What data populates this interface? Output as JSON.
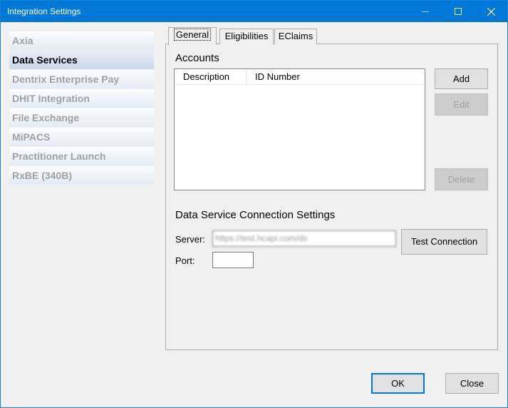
{
  "window": {
    "title": "Integration Settings",
    "accent_color": "#0078d7"
  },
  "nav": {
    "items": [
      {
        "label": "Axia",
        "selected": false
      },
      {
        "label": "Data Services",
        "selected": true
      },
      {
        "label": "Dentrix Enterprise Pay",
        "selected": false
      },
      {
        "label": "DHIT Integration",
        "selected": false
      },
      {
        "label": "File Exchange",
        "selected": false
      },
      {
        "label": "MiPACS",
        "selected": false
      },
      {
        "label": "Practitioner Launch",
        "selected": false
      },
      {
        "label": "RxBE (340B)",
        "selected": false
      }
    ]
  },
  "tabs": [
    {
      "label": "General",
      "active": true
    },
    {
      "label": "Eligibilities",
      "active": false
    },
    {
      "label": "EClaims",
      "active": false
    }
  ],
  "accounts": {
    "title": "Accounts",
    "columns": [
      "Description",
      "ID Number"
    ],
    "rows": [],
    "add_label": "Add",
    "edit_label": "Edit",
    "delete_label": "Delete"
  },
  "connection": {
    "title": "Data Service Connection Settings",
    "server_label": "Server:",
    "server_value": "https://test.hcapi.com/ds",
    "port_label": "Port:",
    "port_value": "",
    "test_label": "Test Connection"
  },
  "footer": {
    "ok_label": "OK",
    "close_label": "Close"
  }
}
